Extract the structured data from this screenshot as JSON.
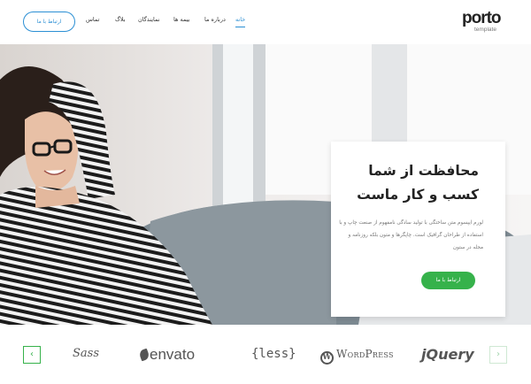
{
  "header": {
    "cta_label": "ارتباط با ما",
    "nav": [
      {
        "label": "خانه",
        "active": true
      },
      {
        "label": "درباره ما",
        "active": false
      },
      {
        "label": "بیمه ها",
        "active": false
      },
      {
        "label": "نمایندگان",
        "active": false
      },
      {
        "label": "بلاگ",
        "active": false
      },
      {
        "label": "تماس",
        "active": false
      }
    ],
    "logo": {
      "word": "porto",
      "tagline": "template"
    }
  },
  "hero": {
    "title_line1": "محافظت از شما",
    "title_line2": "کسب و کار ماست",
    "body": "لورم ایپسوم متن ساختگی با تولید سادگی نامفهوم از صنعت چاپ و با استفاده از طراحان گرافیک است. چاپگرها و متون بلکه روزنامه و مجله در ستون",
    "button_label": "ارتباط با ما"
  },
  "brands": {
    "items": [
      {
        "name": "Sass",
        "label": "Sass"
      },
      {
        "name": "envato",
        "label": "envato"
      },
      {
        "name": "less",
        "label": "{less}"
      },
      {
        "name": "wordpress",
        "label": "WordPress",
        "glyph": "W"
      },
      {
        "name": "jquery",
        "label": "jQuery"
      }
    ],
    "prev_icon": "chevron-left-icon",
    "next_icon": "chevron-right-icon"
  },
  "colors": {
    "accent_blue": "#2b8fd4",
    "accent_green": "#36b24b"
  }
}
